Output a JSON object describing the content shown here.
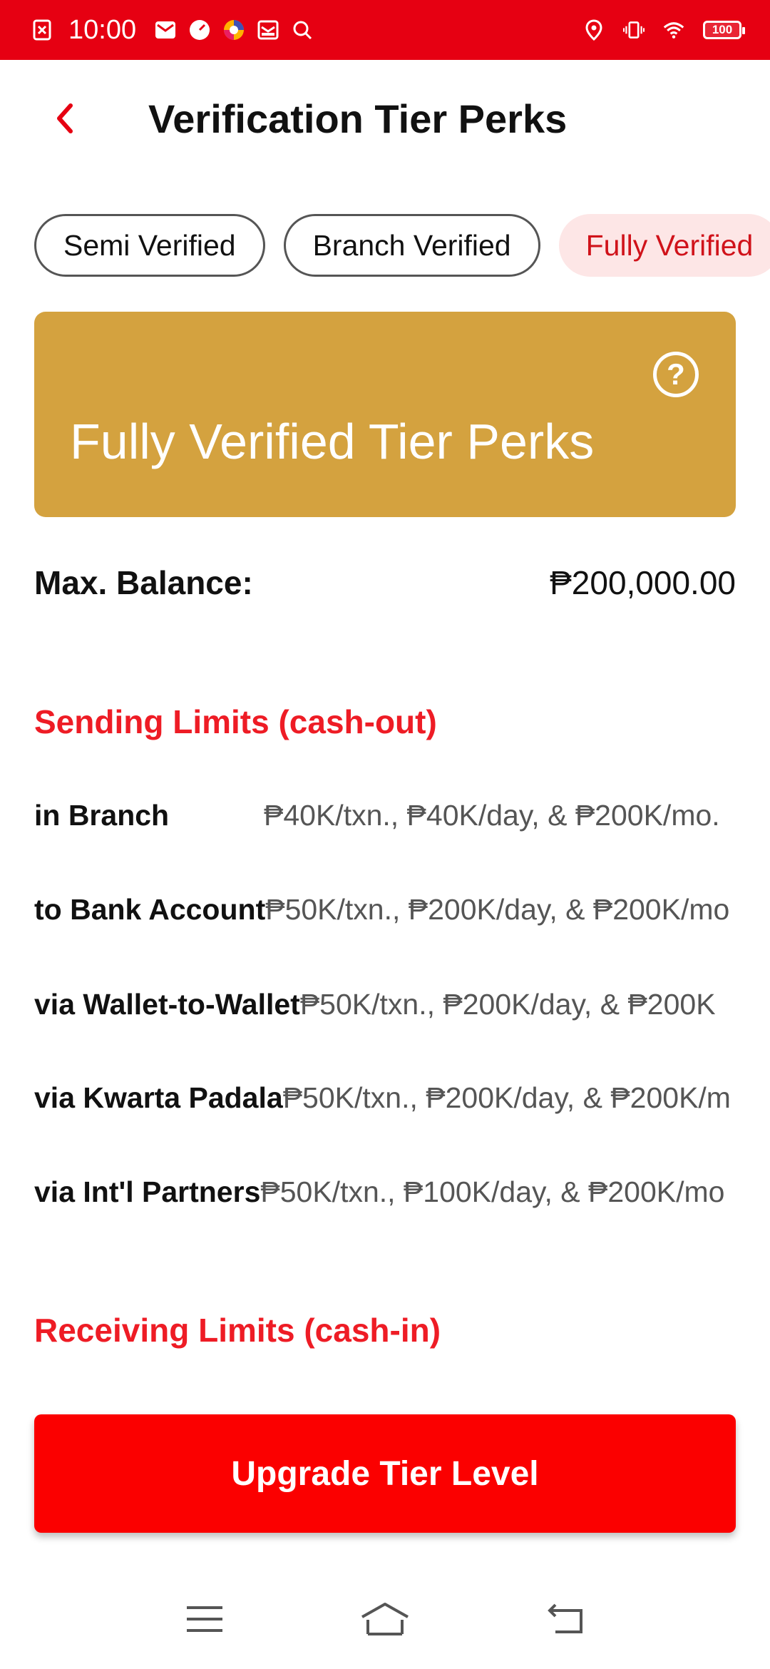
{
  "status_bar": {
    "time": "10:00",
    "battery": "100",
    "left_icons": [
      "close-box-icon",
      "mail-icon",
      "speedometer-icon",
      "browser-icon",
      "inbox-icon",
      "search-icon"
    ],
    "right_icons": [
      "location-icon",
      "vibrate-icon",
      "wifi-icon",
      "battery-icon"
    ],
    "color": "#e60012"
  },
  "header": {
    "title": "Verification Tier Perks",
    "back_icon": "chevron-left-icon"
  },
  "tabs": [
    {
      "label": "Semi Verified",
      "active": false
    },
    {
      "label": "Branch Verified",
      "active": false
    },
    {
      "label": "Fully Verified",
      "active": true
    }
  ],
  "banner": {
    "title": "Fully Verified Tier Perks",
    "help_glyph": "?",
    "color": "#d4a23f"
  },
  "max_balance": {
    "label": "Max. Balance:",
    "value": "₱200,000.00"
  },
  "sending": {
    "title": "Sending Limits (cash-out)",
    "rows": [
      {
        "label": "in Branch",
        "value": "₱40K/txn., ₱40K/day, & ₱200K/mo."
      },
      {
        "label": "to Bank Account",
        "value": "₱50K/txn., ₱200K/day, & ₱200K/mo"
      },
      {
        "label": "via Wallet-to-Wallet",
        "value": "₱50K/txn., ₱200K/day, & ₱200K"
      },
      {
        "label": "via Kwarta Padala",
        "value": "₱50K/txn., ₱200K/day, & ₱200K/m"
      },
      {
        "label": "via Int'l Partners",
        "value": "₱50K/txn., ₱100K/day, & ₱200K/mo"
      }
    ]
  },
  "receiving": {
    "title": "Receiving Limits (cash-in)"
  },
  "upgrade_button": {
    "label": "Upgrade Tier Level",
    "color": "#fb0000"
  },
  "nav_bar": {
    "items": [
      "menu-icon",
      "home-icon",
      "back-icon"
    ]
  }
}
